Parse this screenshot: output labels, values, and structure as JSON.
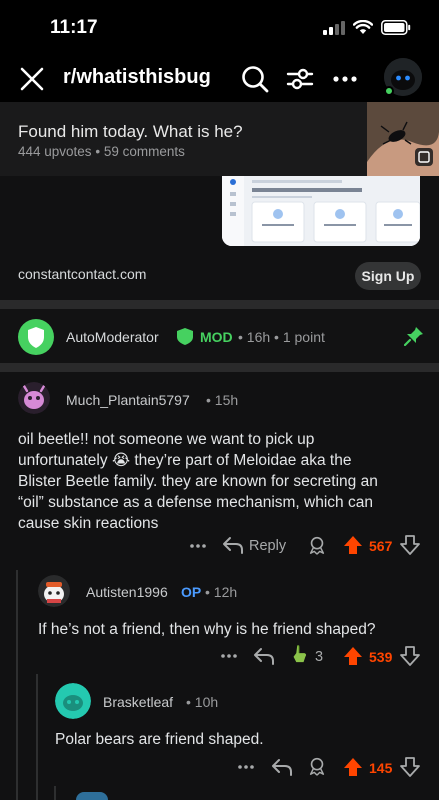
{
  "status": {
    "time": "11:17"
  },
  "header": {
    "subreddit": "r/whatisthisbug"
  },
  "post": {
    "title": "Found him today. What is he?",
    "upvotes": "444 upvotes",
    "comments": "59 comments",
    "meta_sep": "•"
  },
  "ad": {
    "domain": "constantcontact.com",
    "cta": "Sign Up"
  },
  "automod": {
    "user": "AutoModerator",
    "mod": "MOD",
    "age": "16h",
    "points": "1 point",
    "sep": "•"
  },
  "comments": [
    {
      "user": "Much_Plantain5797",
      "age": "15h",
      "body_lines": [
        "oil beetle!! not someone we want to pick up",
        "unfortunately 😭 they’re part of Meloidae aka the",
        "Blister Beetle family. they are known for secreting an",
        "“oil” substance as a defense mechanism, which can",
        "cause skin reactions"
      ],
      "reply_label": "Reply",
      "votes": "567"
    },
    {
      "user": "Autisten1996",
      "op": "OP",
      "age": "12h",
      "body": "If he’s not a friend, then why is he friend shaped?",
      "award_count": "3",
      "votes": "539"
    },
    {
      "user": "Brasketleaf",
      "age": "10h",
      "body": "Polar bears are friend shaped.",
      "votes": "145"
    }
  ],
  "ui": {
    "more_dots": "•••",
    "dot": "•"
  },
  "colors": {
    "upvote": "#ff4500",
    "mod": "#46d160",
    "op": "#4b9bff",
    "bg": "#111112"
  }
}
